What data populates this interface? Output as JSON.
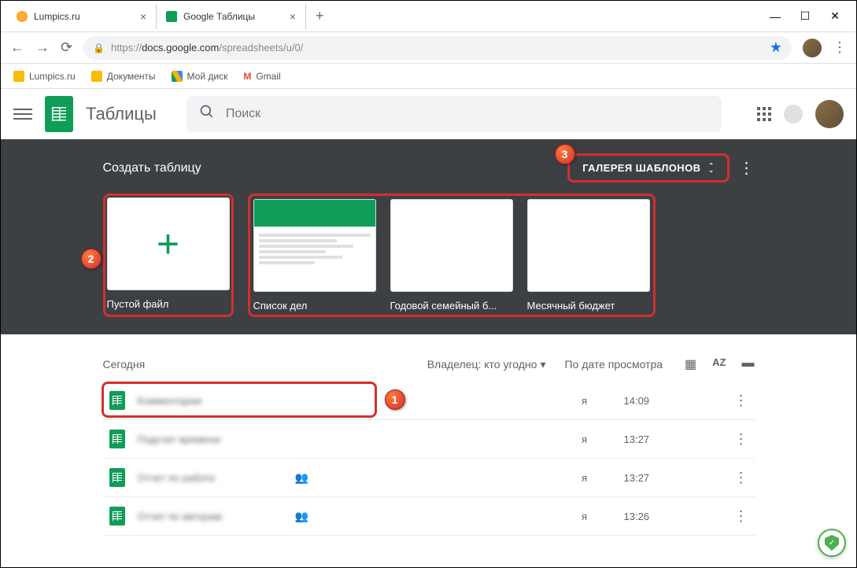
{
  "browser": {
    "tabs": [
      {
        "title": "Lumpics.ru"
      },
      {
        "title": "Google Таблицы"
      }
    ],
    "url_prefix": "https://",
    "url_host": "docs.google.com",
    "url_path": "/spreadsheets/u/0/"
  },
  "bookmarks": [
    {
      "label": "Lumpics.ru"
    },
    {
      "label": "Документы"
    },
    {
      "label": "Мой диск"
    },
    {
      "label": "Gmail"
    }
  ],
  "app": {
    "title": "Таблицы",
    "search_placeholder": "Поиск"
  },
  "templates": {
    "heading": "Создать таблицу",
    "gallery_label": "ГАЛЕРЕЯ ШАБЛОНОВ",
    "items": [
      {
        "label": "Пустой файл"
      },
      {
        "label": "Список дел"
      },
      {
        "label": "Годовой семейный б..."
      },
      {
        "label": "Месячный бюджет"
      }
    ]
  },
  "files": {
    "section": "Сегодня",
    "owner_filter": "Владелец: кто угодно",
    "sort": "По дате просмотра",
    "rows": [
      {
        "name": "Комментарии",
        "owner": "я",
        "time": "14:09",
        "shared": false
      },
      {
        "name": "Подсчет времени",
        "owner": "я",
        "time": "13:27",
        "shared": false
      },
      {
        "name": "Отчет по работе",
        "owner": "я",
        "time": "13:27",
        "shared": true
      },
      {
        "name": "Отчет по авторам",
        "owner": "я",
        "time": "13:26",
        "shared": true
      }
    ]
  },
  "badges": {
    "b1": "1",
    "b2": "2",
    "b3": "3"
  }
}
